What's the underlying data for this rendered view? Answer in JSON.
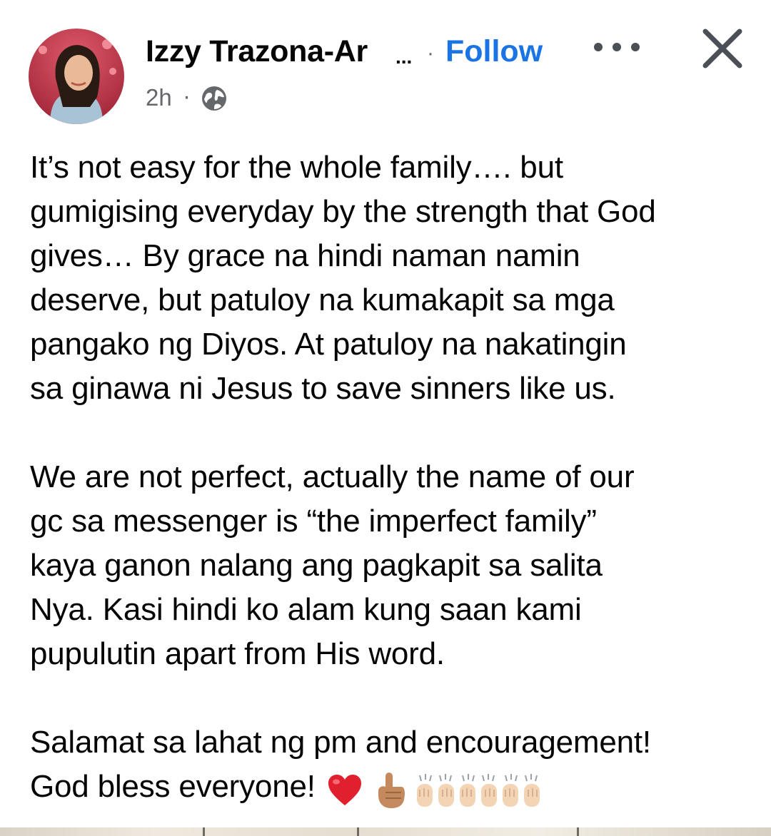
{
  "header": {
    "author_name": "Izzy Trazona-Ar",
    "name_ellipsis": "...",
    "separator": "·",
    "follow_label": "Follow",
    "timestamp": "2h",
    "meta_separator": "·",
    "audience_icon": "globe-icon",
    "more_icon": "more-horizontal-icon",
    "close_icon": "close-icon"
  },
  "post": {
    "paragraphs": [
      "It’s not easy for the whole family…. but\ngumigising everyday by the strength that God\ngives… By grace na hindi naman namin\ndeserve, but patuloy na kumakapit sa mga\npangako ng Diyos. At patuloy na nakatingin\nsa ginawa ni Jesus to save sinners like us.",
      "We are not perfect, actually the name of our\ngc sa messenger is “the imperfect family”\nkaya ganon nalang ang pagkapit sa salita\nNya. Kasi hindi ko alam kung saan kami\npupulutin apart from His word.",
      "Salamat sa lahat ng pm and encouragement!"
    ],
    "last_line": "God bless everyone!",
    "emojis": [
      "red-heart",
      "index-pointing-up",
      "raising-hands",
      "raising-hands",
      "raising-hands"
    ]
  },
  "colors": {
    "follow": "#1b74e4",
    "meta": "#65676b",
    "text": "#050505",
    "heart": "#e0202e",
    "skin": "#f3d5b5"
  }
}
